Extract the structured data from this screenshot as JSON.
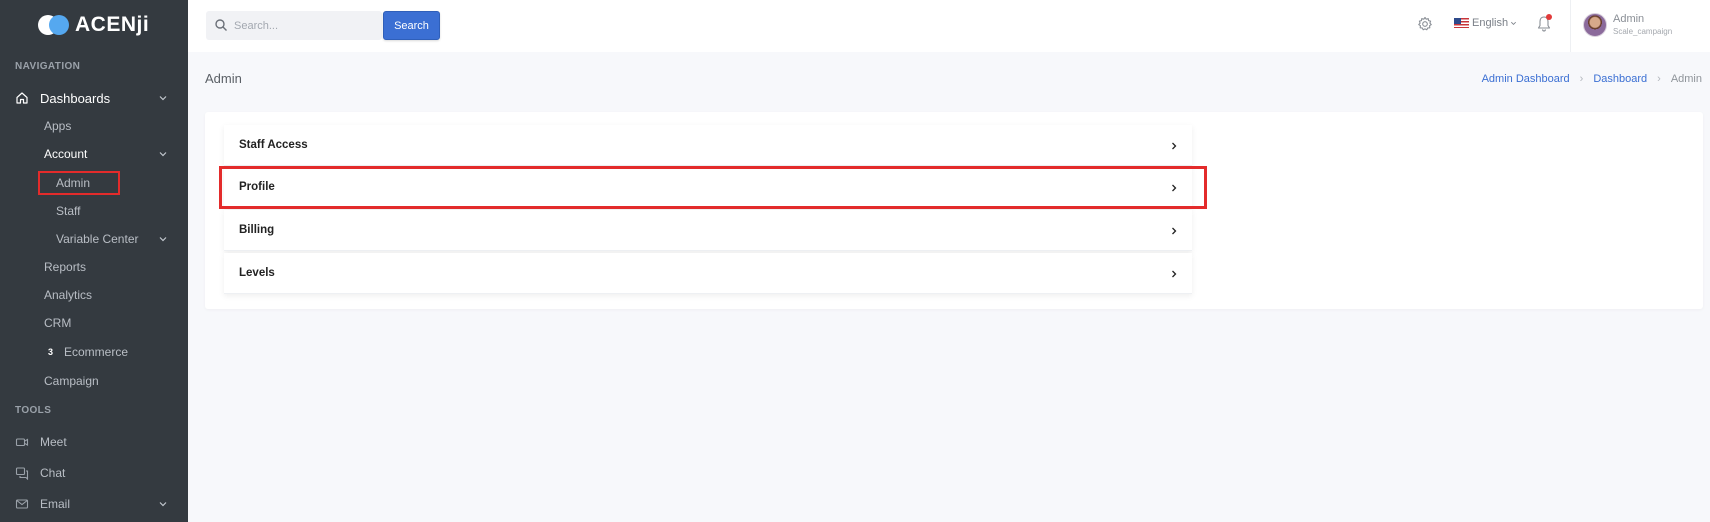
{
  "brand": {
    "name": "ACENji"
  },
  "sidebar": {
    "sections": {
      "navigation": "NAVIGATION",
      "tools": "TOOLS"
    },
    "items": {
      "dashboards": "Dashboards",
      "apps": "Apps",
      "account": "Account",
      "admin": "Admin",
      "staff": "Staff",
      "variable_center": "Variable Center",
      "reports": "Reports",
      "analytics": "Analytics",
      "crm": "CRM",
      "ecommerce": "Ecommerce",
      "ecommerce_badge": "3",
      "campaign": "Campaign",
      "meet": "Meet",
      "chat": "Chat",
      "email": "Email"
    }
  },
  "topbar": {
    "search_placeholder": "Search...",
    "search_button": "Search",
    "language": "English",
    "user": {
      "name": "Admin",
      "subtitle": "Scale_campaign"
    }
  },
  "page": {
    "title": "Admin",
    "breadcrumb": [
      "Admin Dashboard",
      "Dashboard",
      "Admin"
    ]
  },
  "accordion": [
    {
      "label": "Staff Access"
    },
    {
      "label": "Profile"
    },
    {
      "label": "Billing"
    },
    {
      "label": "Levels"
    }
  ],
  "colors": {
    "sidebar_bg": "#343a40",
    "accent": "#3b6fd3",
    "highlight": "#e32b2b",
    "logo_secondary": "#55a8f0"
  }
}
